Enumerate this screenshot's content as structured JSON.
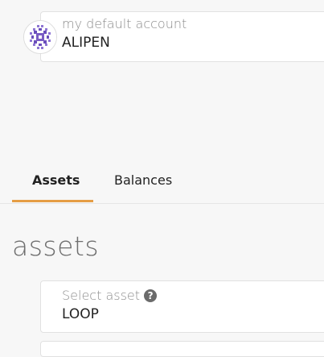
{
  "account": {
    "label": "my default account",
    "name": "ALIPEN",
    "avatar_icon": "identicon-icon"
  },
  "tabs": [
    {
      "label": "Assets",
      "active": true
    },
    {
      "label": "Balances",
      "active": false
    }
  ],
  "section": {
    "title": "assets"
  },
  "asset_select": {
    "label": "Select asset",
    "help_icon": "question-circle-icon",
    "help_glyph": "?",
    "value": "LOOP"
  },
  "colors": {
    "accent": "#e59d45",
    "identicon": "#7a5cc4"
  }
}
